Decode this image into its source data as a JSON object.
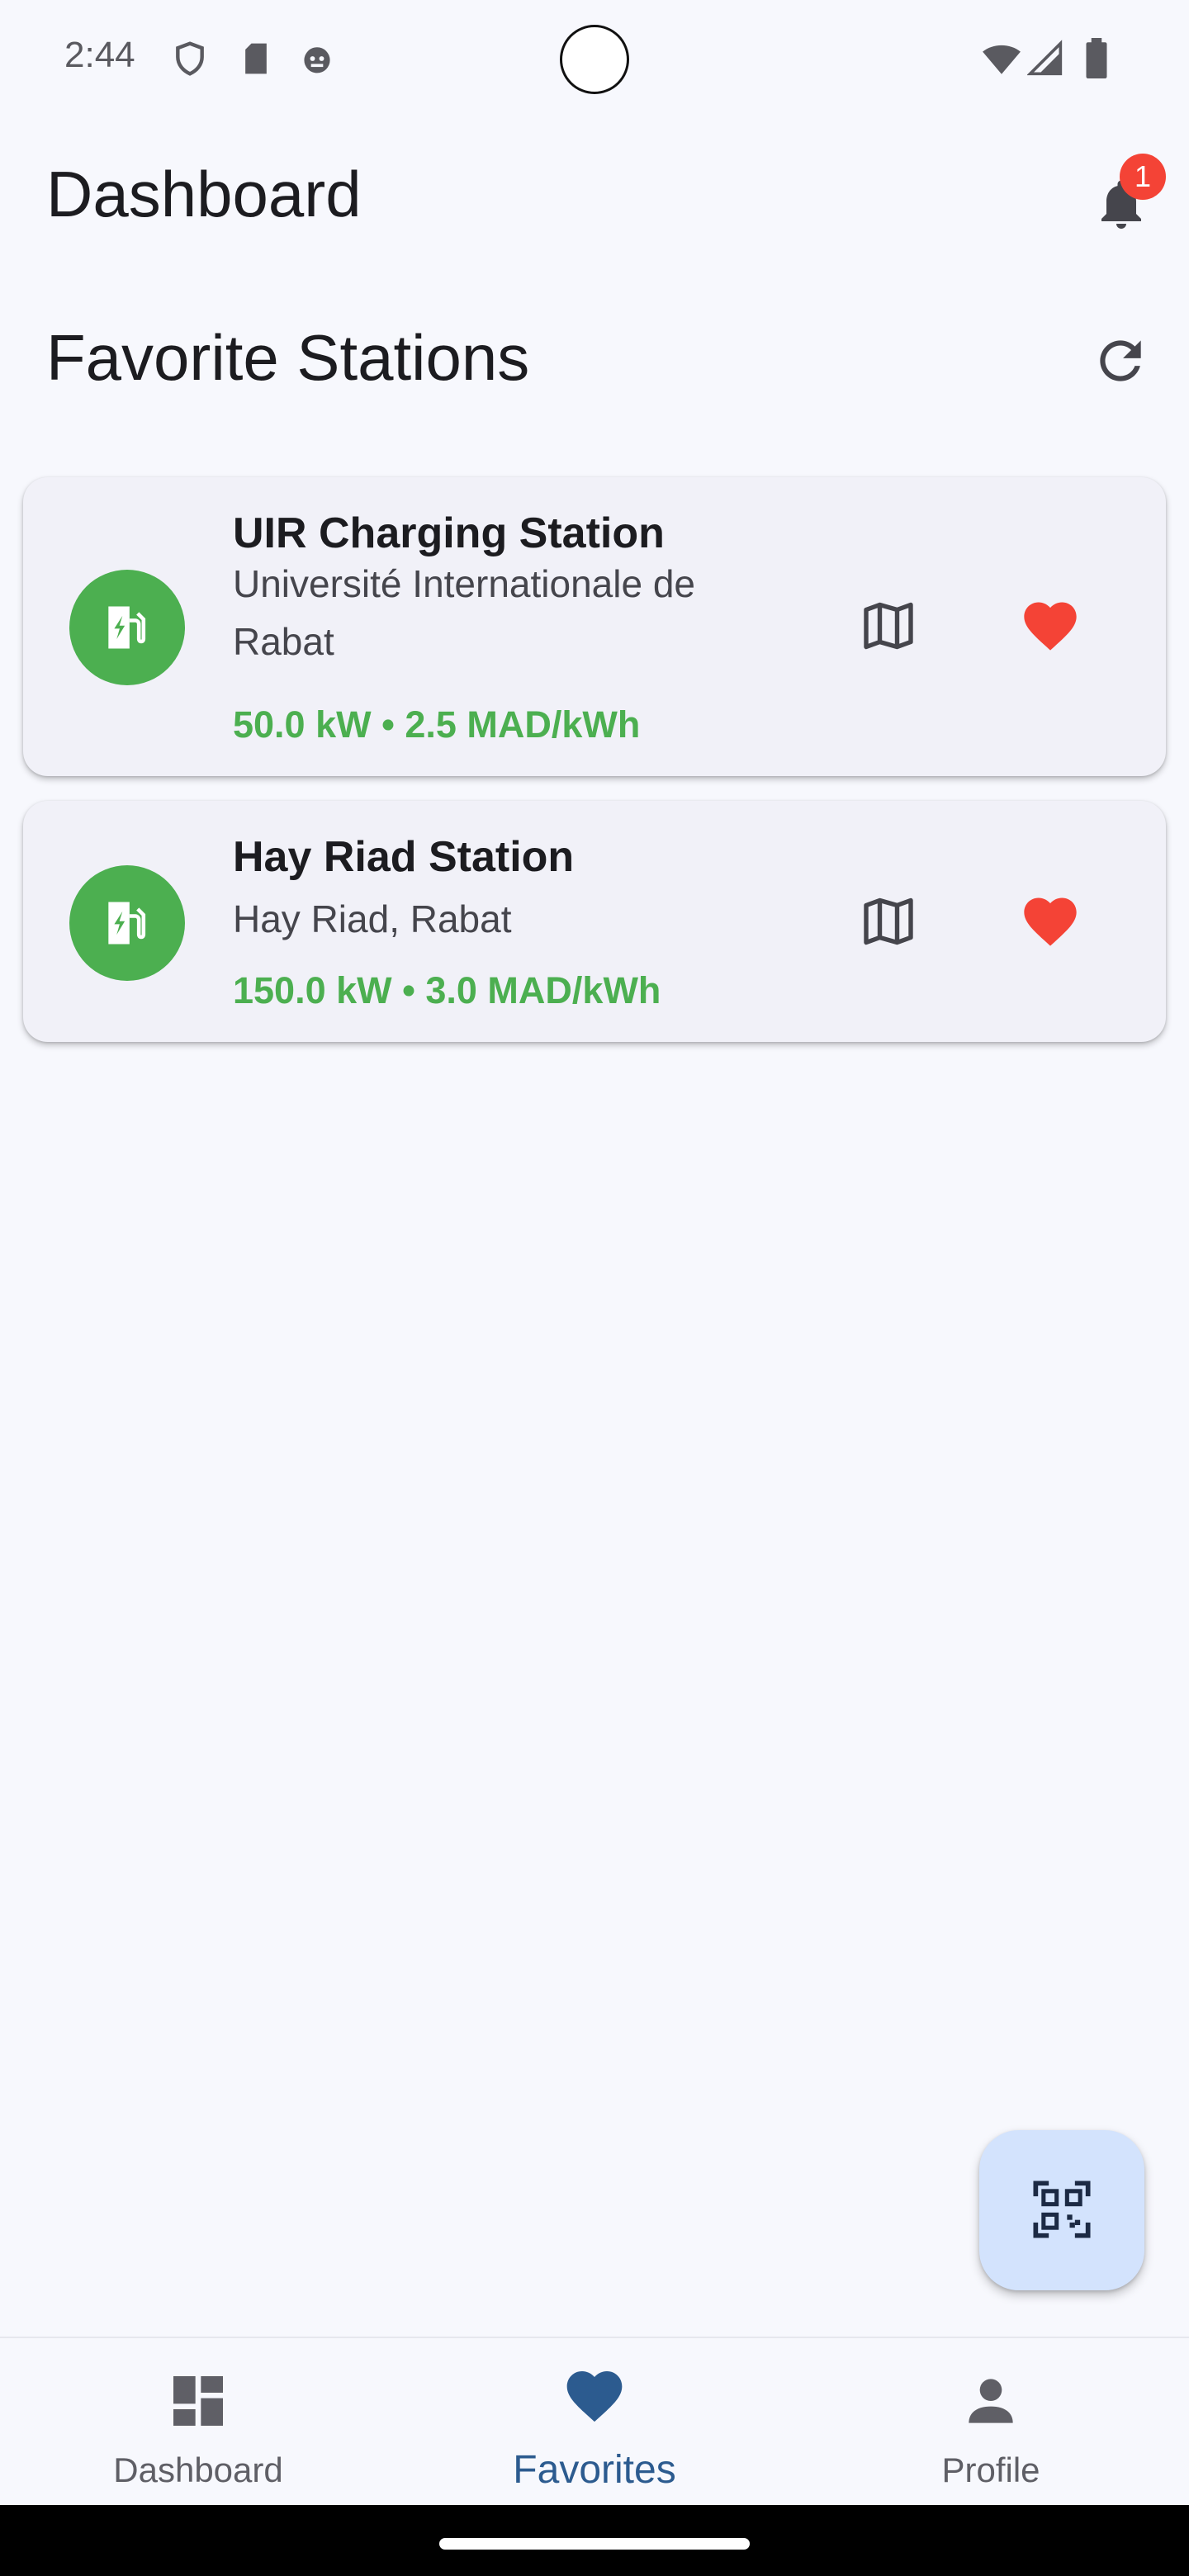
{
  "status_bar": {
    "time": "2:44",
    "left_icons": [
      "shield-icon",
      "sd-card-icon",
      "robot-icon"
    ],
    "right_icons": [
      "wifi-icon",
      "cellular-signal-icon",
      "battery-icon"
    ]
  },
  "app_bar": {
    "title": "Dashboard",
    "notification_count": "1"
  },
  "section": {
    "title": "Favorite Stations",
    "refresh_icon": "refresh-icon"
  },
  "stations": [
    {
      "name": "UIR Charging Station",
      "address": "Université Internationale de Rabat",
      "meta": "50.0 kW • 2.5 MAD/kWh",
      "icon": "ev-station-icon"
    },
    {
      "name": "Hay Riad Station",
      "address": "Hay Riad, Rabat",
      "meta": "150.0 kW • 3.0 MAD/kWh",
      "icon": "ev-station-icon"
    }
  ],
  "fab": {
    "icon": "qr-scanner-icon"
  },
  "bottom_nav": {
    "items": [
      {
        "label": "Dashboard",
        "icon": "dashboard-icon",
        "selected": false
      },
      {
        "label": "Favorites",
        "icon": "heart-icon",
        "selected": true
      },
      {
        "label": "Profile",
        "icon": "person-icon",
        "selected": false
      }
    ]
  },
  "colors": {
    "accent_green": "#4caf50",
    "favorite_red": "#f44336",
    "nav_selected": "#2c5b8f",
    "fab_background": "#d3e3fd"
  }
}
